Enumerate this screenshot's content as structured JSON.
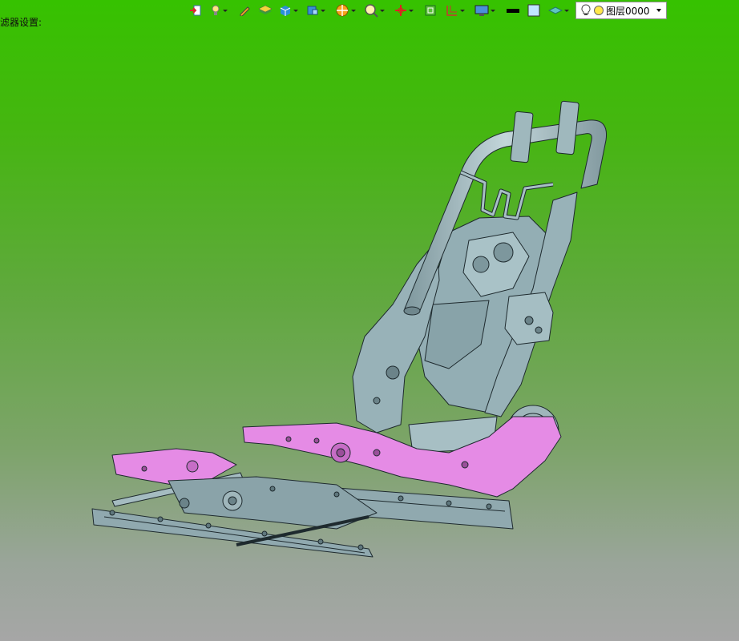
{
  "filter_label": "滤器设置:",
  "toolbar": {
    "icons": [
      "import-icon",
      "light-bulb-icon",
      "pen-icon",
      "layers-stack-icon",
      "box-shaded-icon",
      "view-cube-icon",
      "section-icon",
      "zoom-icon",
      "axis-icon",
      "fit-icon",
      "dimension-icon",
      "display-icon",
      "line-color-icon",
      "fill-color-icon",
      "material-icon"
    ],
    "layer_name": "图层0000",
    "colors": {
      "line": "#000000",
      "fill": "#bfe6ff"
    }
  },
  "viewport": {
    "background_top": "#36c200",
    "background_bottom": "#a6a6a6",
    "model_colors": {
      "frame": "#9eb6bc",
      "highlight": "#e38ae3",
      "edge": "#1e2a2e"
    }
  }
}
